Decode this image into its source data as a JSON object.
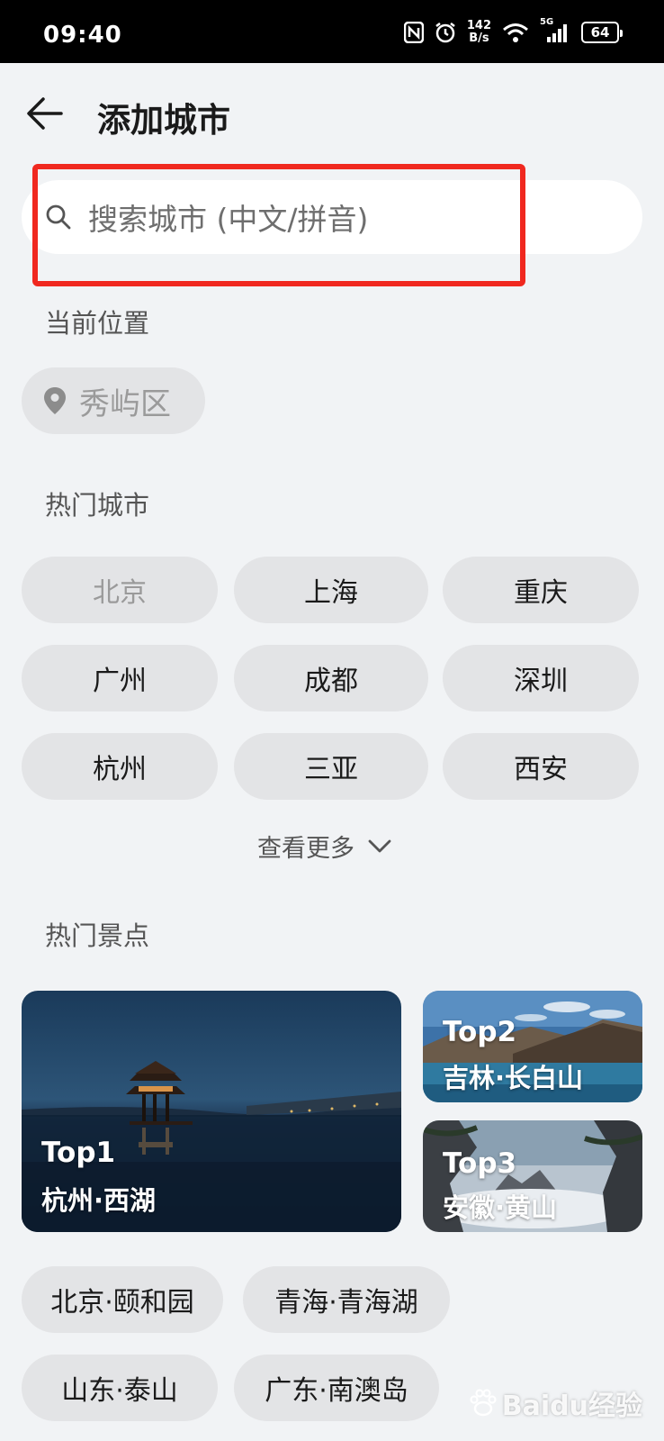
{
  "status_bar": {
    "time": "09:40",
    "net_speed_value": "142",
    "net_speed_unit": "B/s",
    "signal_type": "5G",
    "battery": "64"
  },
  "header": {
    "title": "添加城市"
  },
  "search": {
    "placeholder": "搜索城市 (中文/拼音)"
  },
  "current_location": {
    "section_label": "当前位置",
    "value": "秀屿区"
  },
  "hot_cities": {
    "section_label": "热门城市",
    "items": [
      {
        "label": "北京"
      },
      {
        "label": "上海"
      },
      {
        "label": "重庆"
      },
      {
        "label": "广州"
      },
      {
        "label": "成都"
      },
      {
        "label": "深圳"
      },
      {
        "label": "杭州"
      },
      {
        "label": "三亚"
      },
      {
        "label": "西安"
      }
    ],
    "see_more": "查看更多"
  },
  "hot_spots": {
    "section_label": "热门景点",
    "cards": [
      {
        "rank": "Top1",
        "name": "杭州·西湖"
      },
      {
        "rank": "Top2",
        "name": "吉林·长白山"
      },
      {
        "rank": "Top3",
        "name": "安徽·黄山"
      }
    ],
    "chips": [
      {
        "label": "北京·颐和园"
      },
      {
        "label": "青海·青海湖"
      },
      {
        "label": "山东·泰山"
      },
      {
        "label": "广东·南澳岛"
      }
    ]
  },
  "watermark": {
    "text": "Baidu经验"
  },
  "colors": {
    "highlight": "#f0281f",
    "background": "#f1f3f5",
    "chip": "#e3e4e6"
  }
}
